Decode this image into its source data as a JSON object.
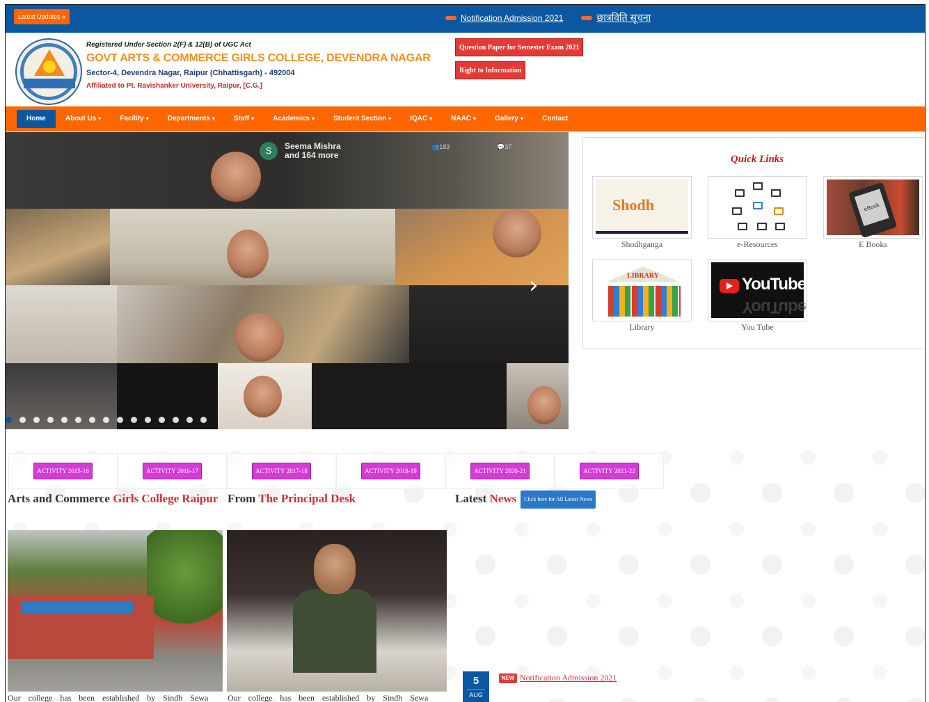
{
  "topbar": {
    "latest_label": "Latest Updates »",
    "ticker": [
      {
        "text": "Notification Admission 2021"
      },
      {
        "text": "छात्रविति सूचना"
      }
    ]
  },
  "header": {
    "reg_line": "Registered Under Section 2(F) & 12(B) of UGC Act",
    "college_name": "GOVT ARTS & COMMERCE GIRLS COLLEGE, DEVENDRA NAGAR",
    "address": "Sector-4, Devendra Nagar, Raipur (Chhattisgarh) - 492004",
    "affiliation": "Affiliated to Pt. Ravishanker University, Raipur, [C.G.]",
    "btn_question_paper": "Question Paper for Semester Exam 2021",
    "btn_rti": "Right to Information"
  },
  "nav": {
    "items": [
      {
        "label": "Home",
        "active": true
      },
      {
        "label": "About Us",
        "dropdown": true
      },
      {
        "label": "Facility",
        "dropdown": true
      },
      {
        "label": "Departments",
        "dropdown": true
      },
      {
        "label": "Staff",
        "dropdown": true
      },
      {
        "label": "Academics",
        "dropdown": true
      },
      {
        "label": "Student Section",
        "dropdown": true
      },
      {
        "label": "IQAC",
        "dropdown": true
      },
      {
        "label": "NAAC",
        "dropdown": true
      },
      {
        "label": "Gallery",
        "dropdown": true
      },
      {
        "label": "Contact"
      }
    ]
  },
  "slider": {
    "caller_initial": "S",
    "caller_line1": "Seema Mishra",
    "caller_line2": "and 164 more",
    "count_a": "183",
    "count_b": "37",
    "total_dots": 15,
    "active_dot": 0
  },
  "quick_links": {
    "title": "Quick Links",
    "items": [
      {
        "label": "Shodhganga",
        "image_text": "Shodh"
      },
      {
        "label": "e-Resources"
      },
      {
        "label": "E Books",
        "image_text": "eBook"
      },
      {
        "label": "Library",
        "image_text": "LIBRARY"
      },
      {
        "label": "You Tube",
        "image_text": "YouTube"
      }
    ]
  },
  "activities": [
    "ACTIVITY 2015-16",
    "ACTIVITY 2016-17",
    "ACTIVITY 2017-18",
    "ACTIVITY 2018-19",
    "ACTIVITY 2020-21",
    "ACTIVITY 2021-22"
  ],
  "sections": {
    "college_title_a": "Arts and Commerce",
    "college_title_b": "Girls College Raipur",
    "principal_title_a": "From",
    "principal_title_b": "The Principal Desk",
    "news_title_a": "Latest",
    "news_title_b": "News",
    "news_button": "Click here for All Latest News",
    "college_desc": "Our college has been established by Sindh Sewa",
    "principal_desc": "Our college has been established by Sindh Sewa"
  },
  "news": [
    {
      "day": "5",
      "month": "AUG",
      "badge": "NEW",
      "title": "Notification Admission 2021"
    }
  ],
  "colors": {
    "topbar": "#0b57a0",
    "nav": "#ff6600",
    "accent_red": "#d03030",
    "activity": "#d63ad8"
  }
}
